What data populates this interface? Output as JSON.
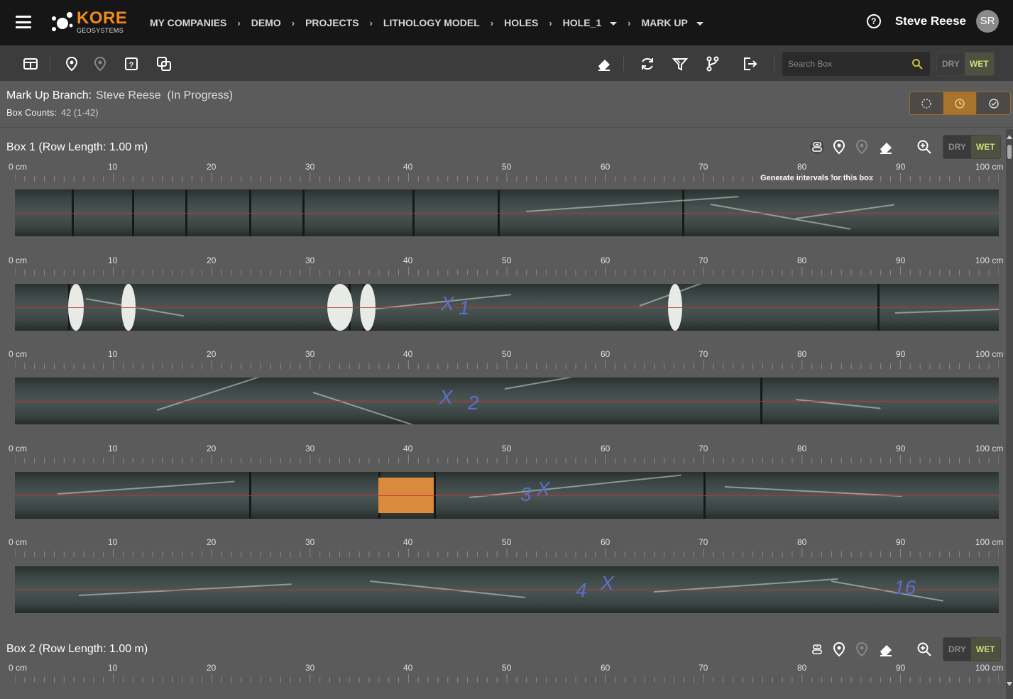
{
  "header": {
    "logo_text": "KORE",
    "logo_sub": "GEOSYSTEMS",
    "breadcrumbs": [
      "MY COMPANIES",
      "DEMO",
      "PROJECTS",
      "LITHOLOGY MODEL",
      "HOLES",
      "HOLE_1",
      "MARK UP"
    ],
    "user_name": "Steve Reese",
    "user_initials": "SR",
    "help": "?"
  },
  "toolbar": {
    "search_placeholder": "Search Box",
    "dry": "DRY",
    "wet": "WET"
  },
  "info": {
    "branch_label": "Mark Up Branch:",
    "branch_value": "Steve Reese  (In Progress)",
    "counts_label": "Box Counts:",
    "counts_value": "42 (1-42)"
  },
  "ruler_labels": [
    "0 cm",
    "10",
    "20",
    "30",
    "40",
    "50",
    "60",
    "70",
    "80",
    "90",
    "100 cm"
  ],
  "boxes": [
    {
      "title": "Box 1 (Row Length: 1.00 m)",
      "dry": "DRY",
      "wet": "WET",
      "tooltip": "Generate intervals for this box"
    },
    {
      "title": "Box 2 (Row Length: 1.00 m)",
      "dry": "DRY",
      "wet": "WET"
    }
  ],
  "core_marks": [
    "1",
    "2",
    "3",
    "4",
    "16"
  ],
  "colors": {
    "accent": "#f08a1c",
    "wet": "#c9e07a",
    "status_active": "#a8732d"
  }
}
